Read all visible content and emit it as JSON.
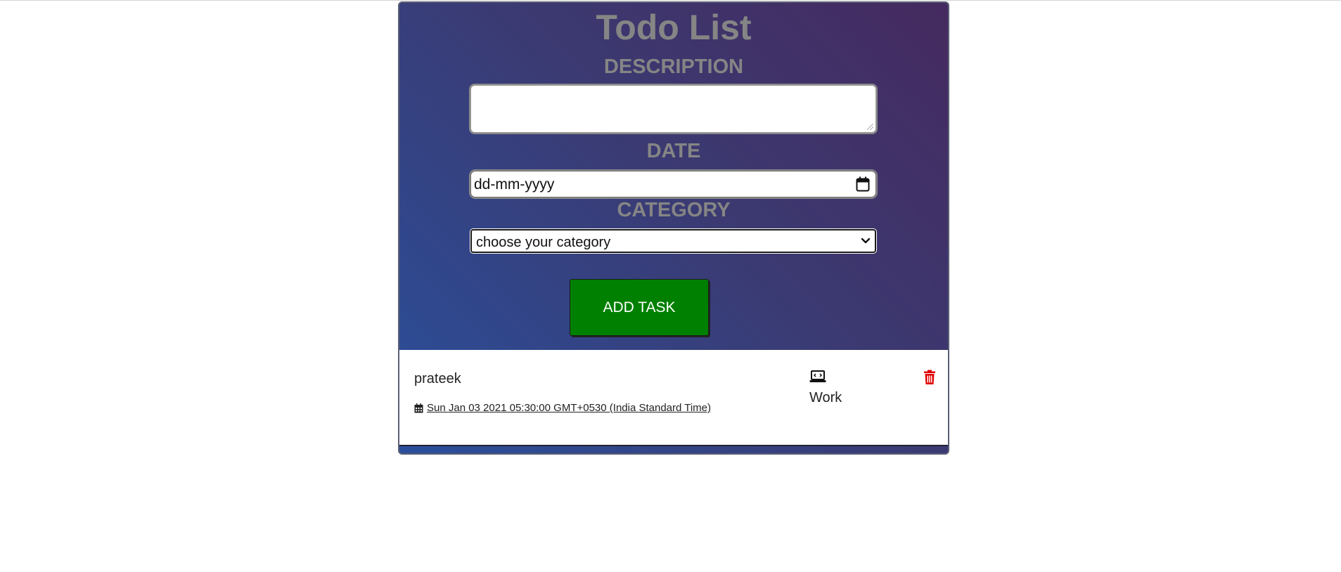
{
  "app": {
    "title": "Todo List"
  },
  "form": {
    "description_label": "DESCRIPTION",
    "description_value": "",
    "date_label": "DATE",
    "date_placeholder": "dd-mm-yyyy",
    "category_label": "CATEGORY",
    "category_selected": "choose your category",
    "add_button_label": "ADD TASK"
  },
  "tasks": [
    {
      "description": "prateek",
      "date": "Sun Jan 03 2021 05:30:00 GMT+0530 (India Standard Time)",
      "category": "Work",
      "category_icon": "laptop-code-icon",
      "date_icon": "calendar-icon",
      "delete_icon": "trash-icon"
    }
  ],
  "colors": {
    "button_green": "#008000",
    "delete_red": "#e00000",
    "label_gray": "#858585"
  }
}
